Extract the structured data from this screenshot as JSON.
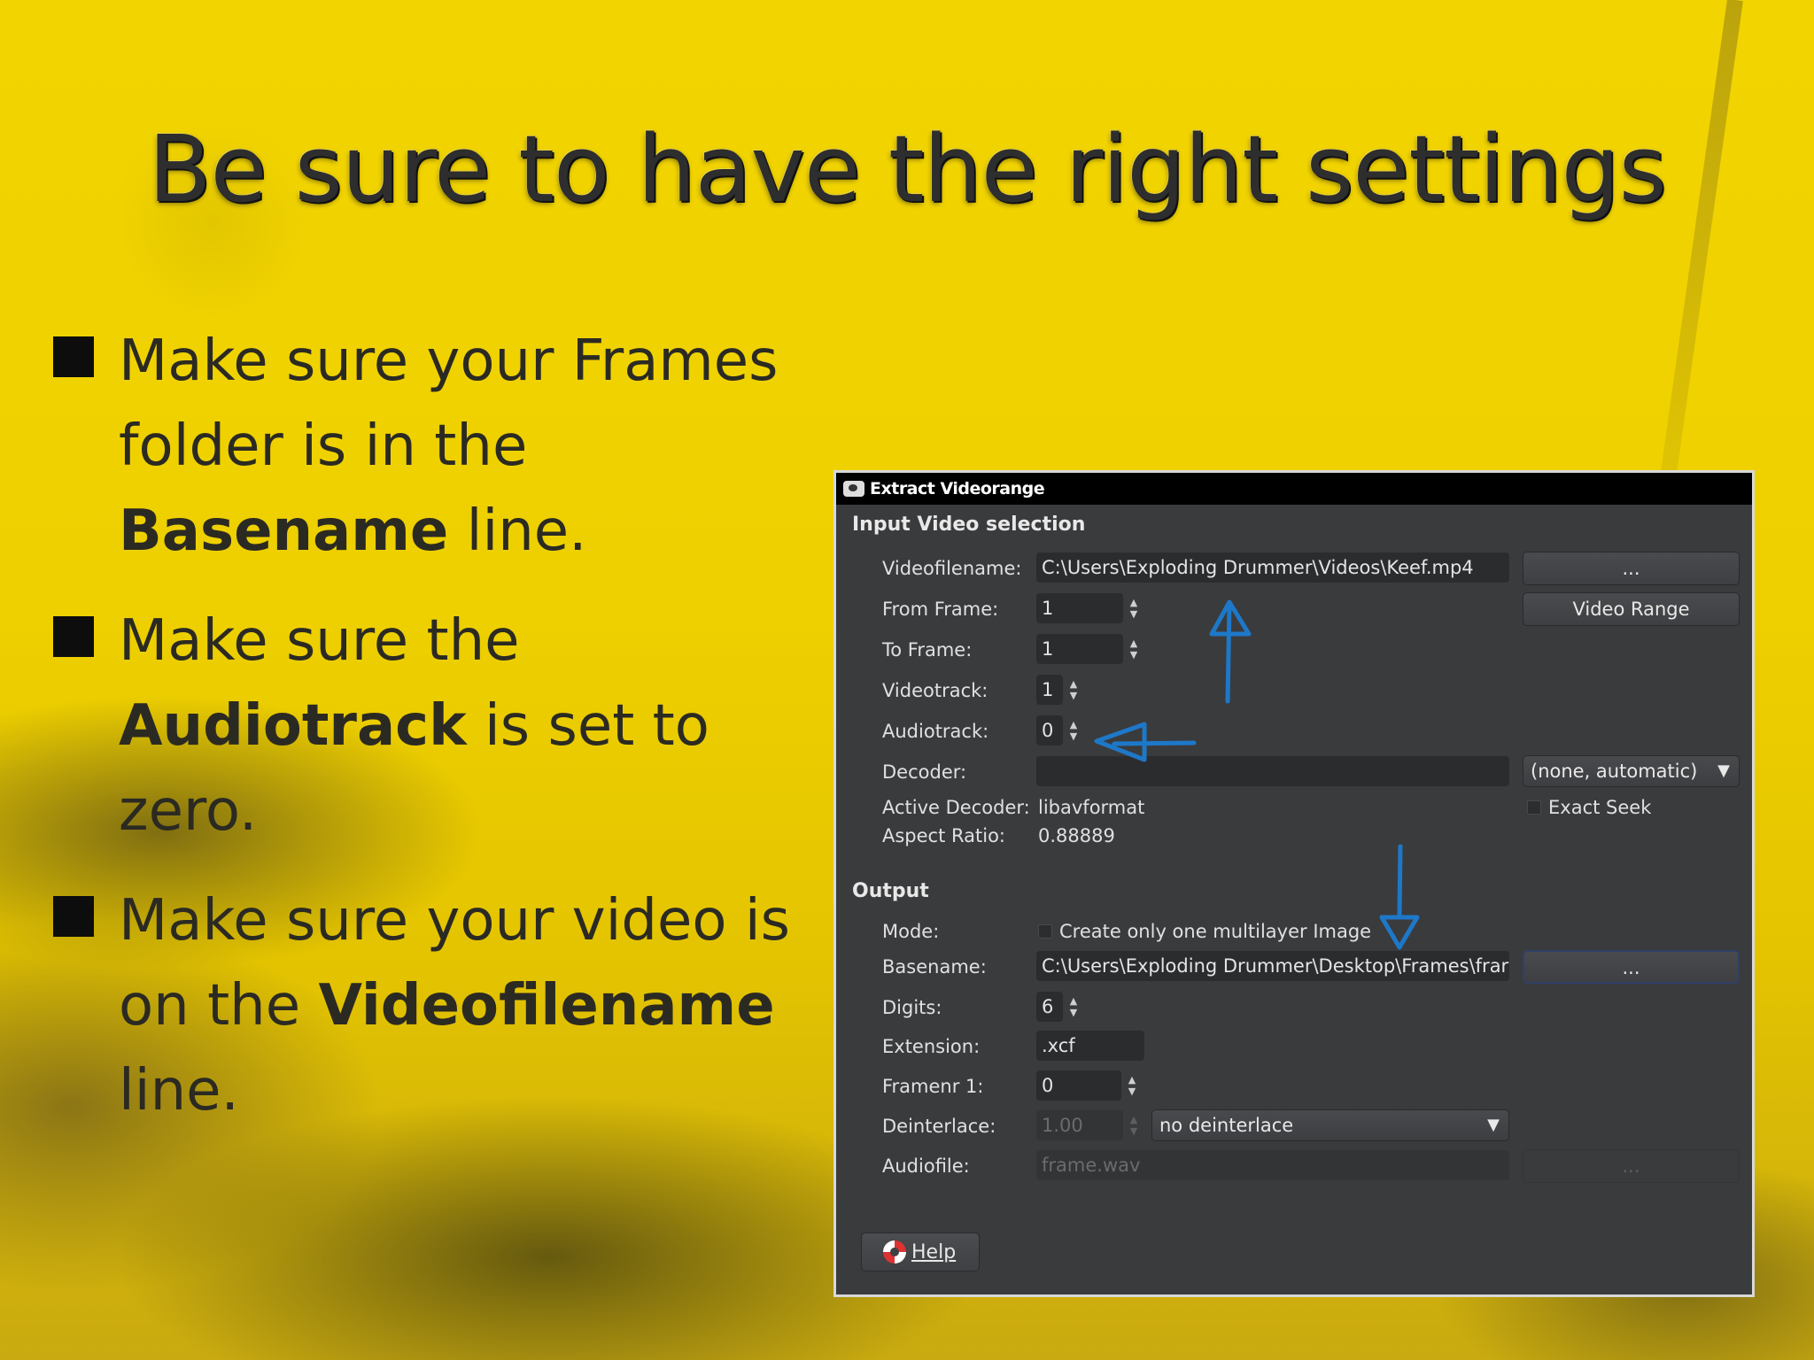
{
  "slide": {
    "title": "Be sure to have the right settings",
    "bullets": [
      {
        "pre": "Make sure your Frames folder is in the ",
        "bold": "Basename",
        "post": " line."
      },
      {
        "pre": "Make sure the ",
        "bold": "Audiotrack",
        "post": " is set to zero."
      },
      {
        "pre": "Make sure your video is on the ",
        "bold": "Videofilename",
        "post": " line."
      }
    ]
  },
  "dialog": {
    "title": "Extract Videorange",
    "input_section": "Input Video selection",
    "labels": {
      "videofilename": "Videofilename:",
      "from_frame": "From Frame:",
      "to_frame": "To Frame:",
      "videotrack": "Videotrack:",
      "audiotrack": "Audiotrack:",
      "decoder": "Decoder:",
      "active_decoder": "Active Decoder:",
      "aspect_ratio": "Aspect Ratio:",
      "mode": "Mode:",
      "basename": "Basename:",
      "digits": "Digits:",
      "extension": "Extension:",
      "framenr1": "Framenr 1:",
      "deinterlace": "Deinterlace:",
      "audiofile": "Audiofile:"
    },
    "values": {
      "videofilename": "C:\\Users\\Exploding Drummer\\Videos\\Keef.mp4",
      "from_frame": "1",
      "to_frame": "1",
      "videotrack": "1",
      "audiotrack": "0",
      "decoder": "",
      "decoder_option": "(none, automatic)",
      "active_decoder": "libavformat",
      "aspect_ratio": "0.88889",
      "mode_option": "Create only one multilayer Image",
      "basename": "C:\\Users\\Exploding Drummer\\Desktop\\Frames\\frar",
      "digits": "6",
      "extension": ".xcf",
      "framenr1": "0",
      "deinterlace_value": "1.00",
      "deinterlace_option": "no deinterlace",
      "audiofile": "frame.wav"
    },
    "buttons": {
      "browse": "...",
      "video_range": "Video Range",
      "exact_seek": "Exact Seek",
      "help": "Help"
    },
    "output_section": "Output"
  },
  "colors": {
    "background": "#eed000",
    "title_text": "#2e2e2e",
    "dialog_bg": "#3a3b3d",
    "annotation_arrow": "#1e78c8"
  }
}
